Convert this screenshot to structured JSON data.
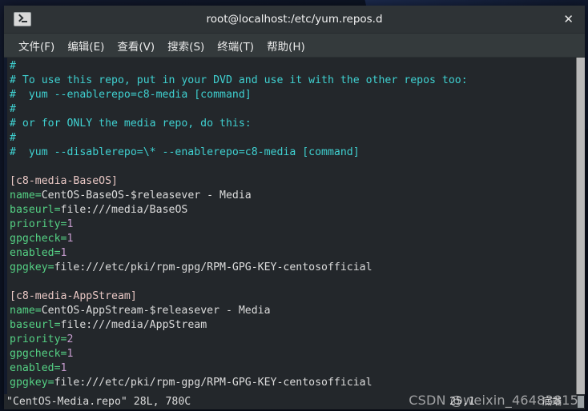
{
  "window": {
    "title": "root@localhost:/etc/yum.repos.d",
    "icon": "terminal-icon",
    "close_label": "✕"
  },
  "menubar": {
    "items": [
      {
        "label": "文件(F)"
      },
      {
        "label": "编辑(E)"
      },
      {
        "label": "查看(V)"
      },
      {
        "label": "搜索(S)"
      },
      {
        "label": "终端(T)"
      },
      {
        "label": "帮助(H)"
      }
    ]
  },
  "terminal": {
    "lines": [
      {
        "type": "comment",
        "text": "#"
      },
      {
        "type": "comment",
        "text": "# To use this repo, put in your DVD and use it with the other repos too:"
      },
      {
        "type": "comment",
        "text": "#  yum --enablerepo=c8-media [command]"
      },
      {
        "type": "comment",
        "text": "#"
      },
      {
        "type": "comment",
        "text": "# or for ONLY the media repo, do this:"
      },
      {
        "type": "comment",
        "text": "#"
      },
      {
        "type": "comment",
        "text": "#  yum --disablerepo=\\* --enablerepo=c8-media [command]"
      },
      {
        "type": "blank",
        "text": ""
      },
      {
        "type": "section",
        "text": "[c8-media-BaseOS]"
      },
      {
        "type": "kv",
        "key": "name=",
        "value": "CentOS-BaseOS-$releasever - Media"
      },
      {
        "type": "kv",
        "key": "baseurl=",
        "value": "file:///media/BaseOS"
      },
      {
        "type": "kvnum",
        "key": "priority=",
        "value": "1"
      },
      {
        "type": "kvnum",
        "key": "gpgcheck=",
        "value": "1"
      },
      {
        "type": "kvnum",
        "key": "enabled=",
        "value": "1"
      },
      {
        "type": "kv",
        "key": "gpgkey=",
        "value": "file:///etc/pki/rpm-gpg/RPM-GPG-KEY-centosofficial"
      },
      {
        "type": "blank",
        "text": ""
      },
      {
        "type": "section",
        "text": "[c8-media-AppStream]"
      },
      {
        "type": "kv",
        "key": "name=",
        "value": "CentOS-AppStream-$releasever - Media"
      },
      {
        "type": "kv",
        "key": "baseurl=",
        "value": "file:///media/AppStream"
      },
      {
        "type": "kvnum",
        "key": "priority=",
        "value": "2"
      },
      {
        "type": "kvnum",
        "key": "gpgcheck=",
        "value": "1"
      },
      {
        "type": "kvnum",
        "key": "enabled=",
        "value": "1"
      },
      {
        "type": "kv",
        "key": "gpgkey=",
        "value": "file:///etc/pki/rpm-gpg/RPM-GPG-KEY-centosofficial"
      }
    ]
  },
  "statusline": {
    "file_info": "\"CentOS-Media.repo\" 28L, 780C",
    "position": "25,1",
    "location": "底端"
  },
  "watermark": {
    "text": "CSDN @weixin_46483815"
  },
  "colors": {
    "titlebar_bg": "#2e3336",
    "menubar_bg": "#343a3c",
    "terminal_bg": "#23272b",
    "comment": "#3fd0d0",
    "section": "#e8c7c4",
    "key": "#55d184",
    "value": "#dcdcdc",
    "number": "#c49bcc",
    "scrollbar": "#b9b9b9"
  }
}
